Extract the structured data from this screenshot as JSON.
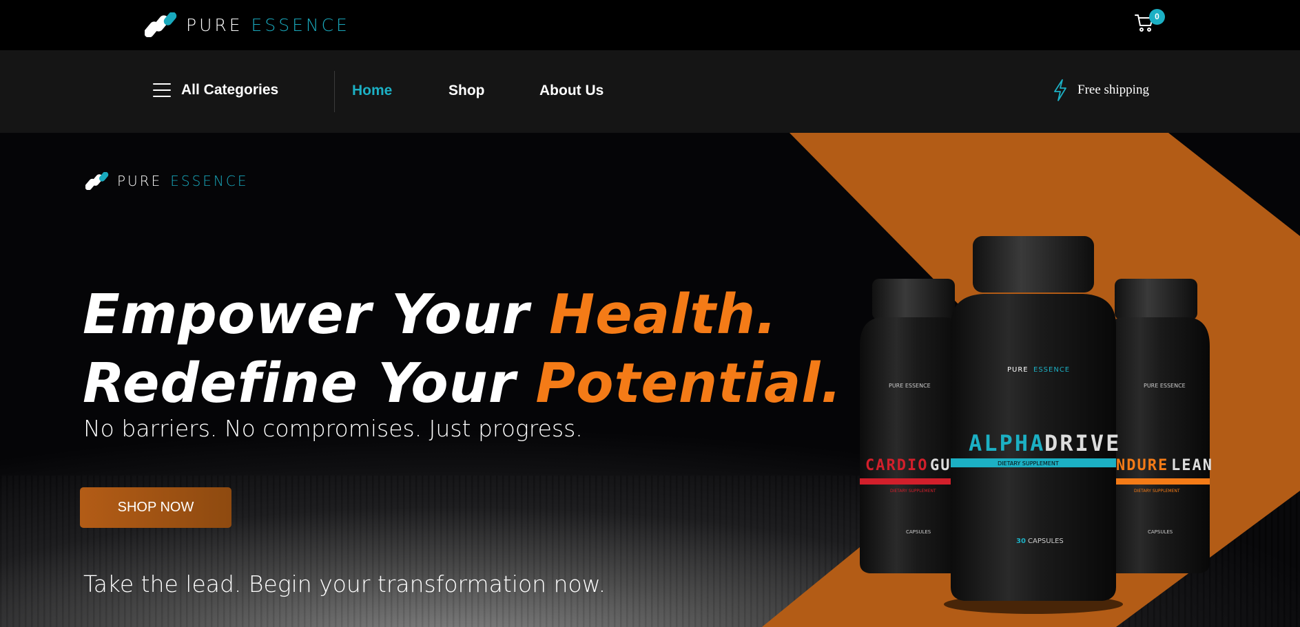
{
  "topbar": {
    "logo": {
      "brand_primary": "PURE",
      "brand_secondary": "ESSENCE"
    },
    "cart": {
      "icon": "cart-icon",
      "count": "0"
    }
  },
  "nav": {
    "categories_label": "All Categories",
    "links": [
      {
        "label": "Home",
        "active": true
      },
      {
        "label": "Shop",
        "active": false
      },
      {
        "label": "About Us",
        "active": false
      }
    ],
    "shipping": {
      "icon": "lightning-icon",
      "label": "Free shipping"
    }
  },
  "hero": {
    "logo": {
      "brand_primary": "PURE",
      "brand_secondary": "ESSENCE"
    },
    "headline": {
      "line1_plain": "Empower Your ",
      "line1_accent": "Health.",
      "line2_plain": "Redefine Your ",
      "line2_accent": "Potential."
    },
    "subline": "No barriers. No compromises. Just progress.",
    "cta_label": "SHOP NOW",
    "tagline": "Take the lead. Begin your transformation now.",
    "products": [
      {
        "name_a": "CARDIO",
        "name_b": "GUA",
        "label": "DIETARY SUPPLEMENT",
        "capsules": "CAPSULES",
        "brand": "PURE ESSENCE"
      },
      {
        "name_a": "ALPHA",
        "name_b": "DRIVE",
        "label": "DIETARY SUPPLEMENT",
        "capsules_num": "30",
        "capsules": "CAPSULES",
        "brand_a": "PURE",
        "brand_b": "ESSENCE"
      },
      {
        "name_a": "NDURE",
        "name_b": "LEAN",
        "label": "DIETARY SUPPLEMENT",
        "capsules": "CAPSULES",
        "brand": "PURE ESSENCE"
      }
    ]
  },
  "colors": {
    "accent_teal": "#1cb0c4",
    "accent_orange": "#f47b17",
    "banner_orange": "#b35c16",
    "nav_bg": "#151515",
    "top_bg": "#000000",
    "cardio_red": "#d21f2b"
  }
}
